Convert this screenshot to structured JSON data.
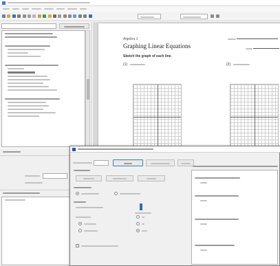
{
  "worksheet": {
    "header_left": "Algebra 1",
    "title": "Graphing Linear Equations",
    "instruction": "Sketch the graph of each line.",
    "problems": [
      {
        "label": "(1)"
      },
      {
        "label": "(2)"
      }
    ]
  },
  "colors": {
    "window_bg": "#f0f0f0",
    "doc_bg": "#d9d9d9",
    "dialog_title": "#2b5797"
  }
}
